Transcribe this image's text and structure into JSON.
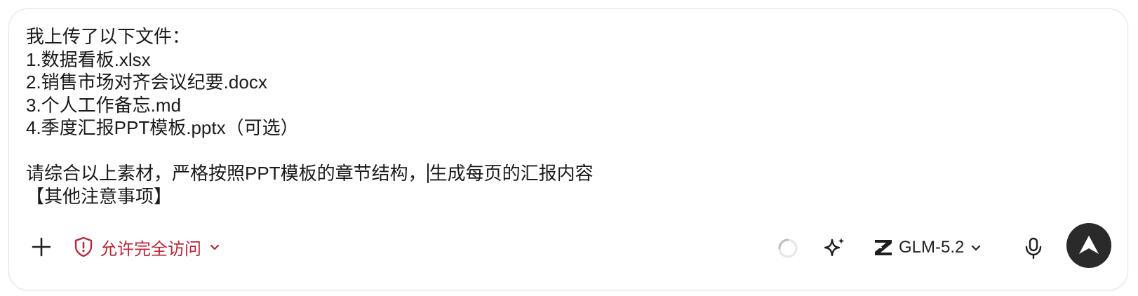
{
  "composer": {
    "lines": [
      "我上传了以下文件：",
      "1.数据看板.xlsx",
      "2.销售市场对齐会议纪要.docx",
      "3.个人工作备忘.md",
      "4.季度汇报PPT模板.pptx（可选）"
    ],
    "instruction_before_cursor": "请综合以上素材，严格按照PPT模板的章节结构，",
    "instruction_after_cursor": "生成每页的汇报内容",
    "notes_line": "【其他注意事项】"
  },
  "toolbar": {
    "add_icon": "plus-icon",
    "access_label": "允许完全访问",
    "access_icon": "shield-alert-icon",
    "access_color": "#b5293a",
    "spinner_icon": "loading-spinner-icon",
    "enhance_icon": "sparkle-icon",
    "model_label": "GLM-5.2",
    "model_icon": "zhipu-z-logo-icon",
    "mic_icon": "microphone-icon",
    "send_icon": "send-arrow-icon",
    "send_bg": "#2a2a2a"
  }
}
